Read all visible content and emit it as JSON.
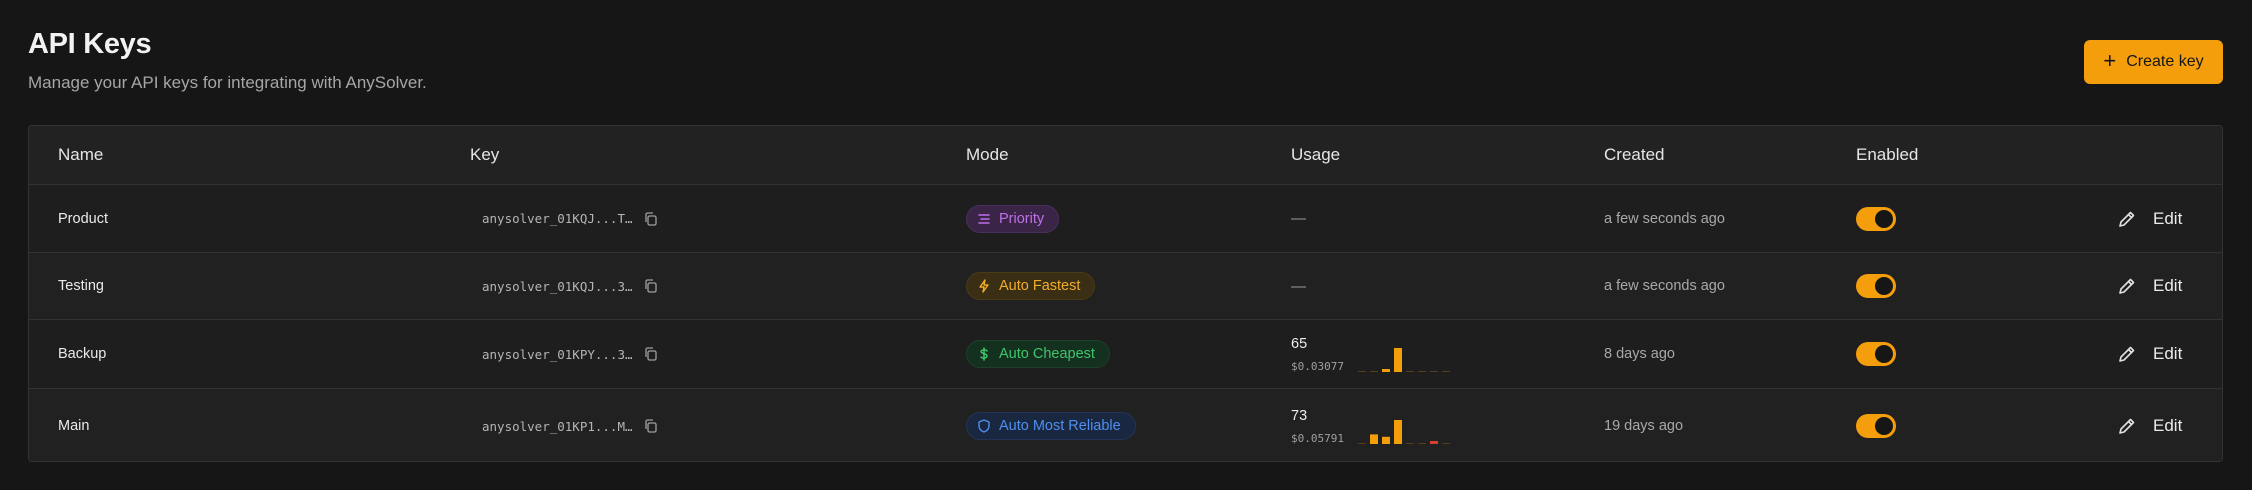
{
  "header": {
    "title": "API Keys",
    "subtitle": "Manage your API keys for integrating with AnySolver.",
    "create_label": "Create key"
  },
  "table": {
    "columns": {
      "name": "Name",
      "key": "Key",
      "mode": "Mode",
      "usage": "Usage",
      "created": "Created",
      "enabled": "Enabled"
    },
    "edit_label": "Edit",
    "rows": [
      {
        "name": "Product",
        "key": "anysolver_01KQJ...T…",
        "mode": "Priority",
        "mode_kind": "priority",
        "usage_empty": "—",
        "created": "a few seconds ago",
        "enabled": true
      },
      {
        "name": "Testing",
        "key": "anysolver_01KQJ...3…",
        "mode": "Auto Fastest",
        "mode_kind": "fastest",
        "usage_empty": "—",
        "created": "a few seconds ago",
        "enabled": true
      },
      {
        "name": "Backup",
        "key": "anysolver_01KPY...3…",
        "mode": "Auto Cheapest",
        "mode_kind": "cheapest",
        "usage_count": "65",
        "usage_cost": "$0.03077",
        "spark": [
          0,
          0,
          0.12,
          1,
          0,
          0,
          0,
          0
        ],
        "created": "8 days ago",
        "enabled": true
      },
      {
        "name": "Main",
        "key": "anysolver_01KP1...M…",
        "mode": "Auto Most Reliable",
        "mode_kind": "reliable",
        "usage_count": "73",
        "usage_cost": "$0.05791",
        "spark": [
          0,
          0.4,
          0.3,
          1,
          0,
          0,
          0.12,
          0
        ],
        "spark_red_index": 6,
        "created": "19 days ago",
        "enabled": true
      }
    ]
  },
  "colors": {
    "accent": "#f59e0b",
    "background": "#161616",
    "priority": "#c06fe8",
    "fastest": "#f0ae28",
    "cheapest": "#3fc56b",
    "reliable": "#4f8fef",
    "spark_red": "#d9402b"
  },
  "icons": {
    "create": "plus-icon",
    "copy": "copy-icon",
    "priority": "list-icon",
    "fastest": "lightning-icon",
    "cheapest": "dollar-icon",
    "reliable": "shield-icon",
    "edit": "pencil-icon"
  }
}
